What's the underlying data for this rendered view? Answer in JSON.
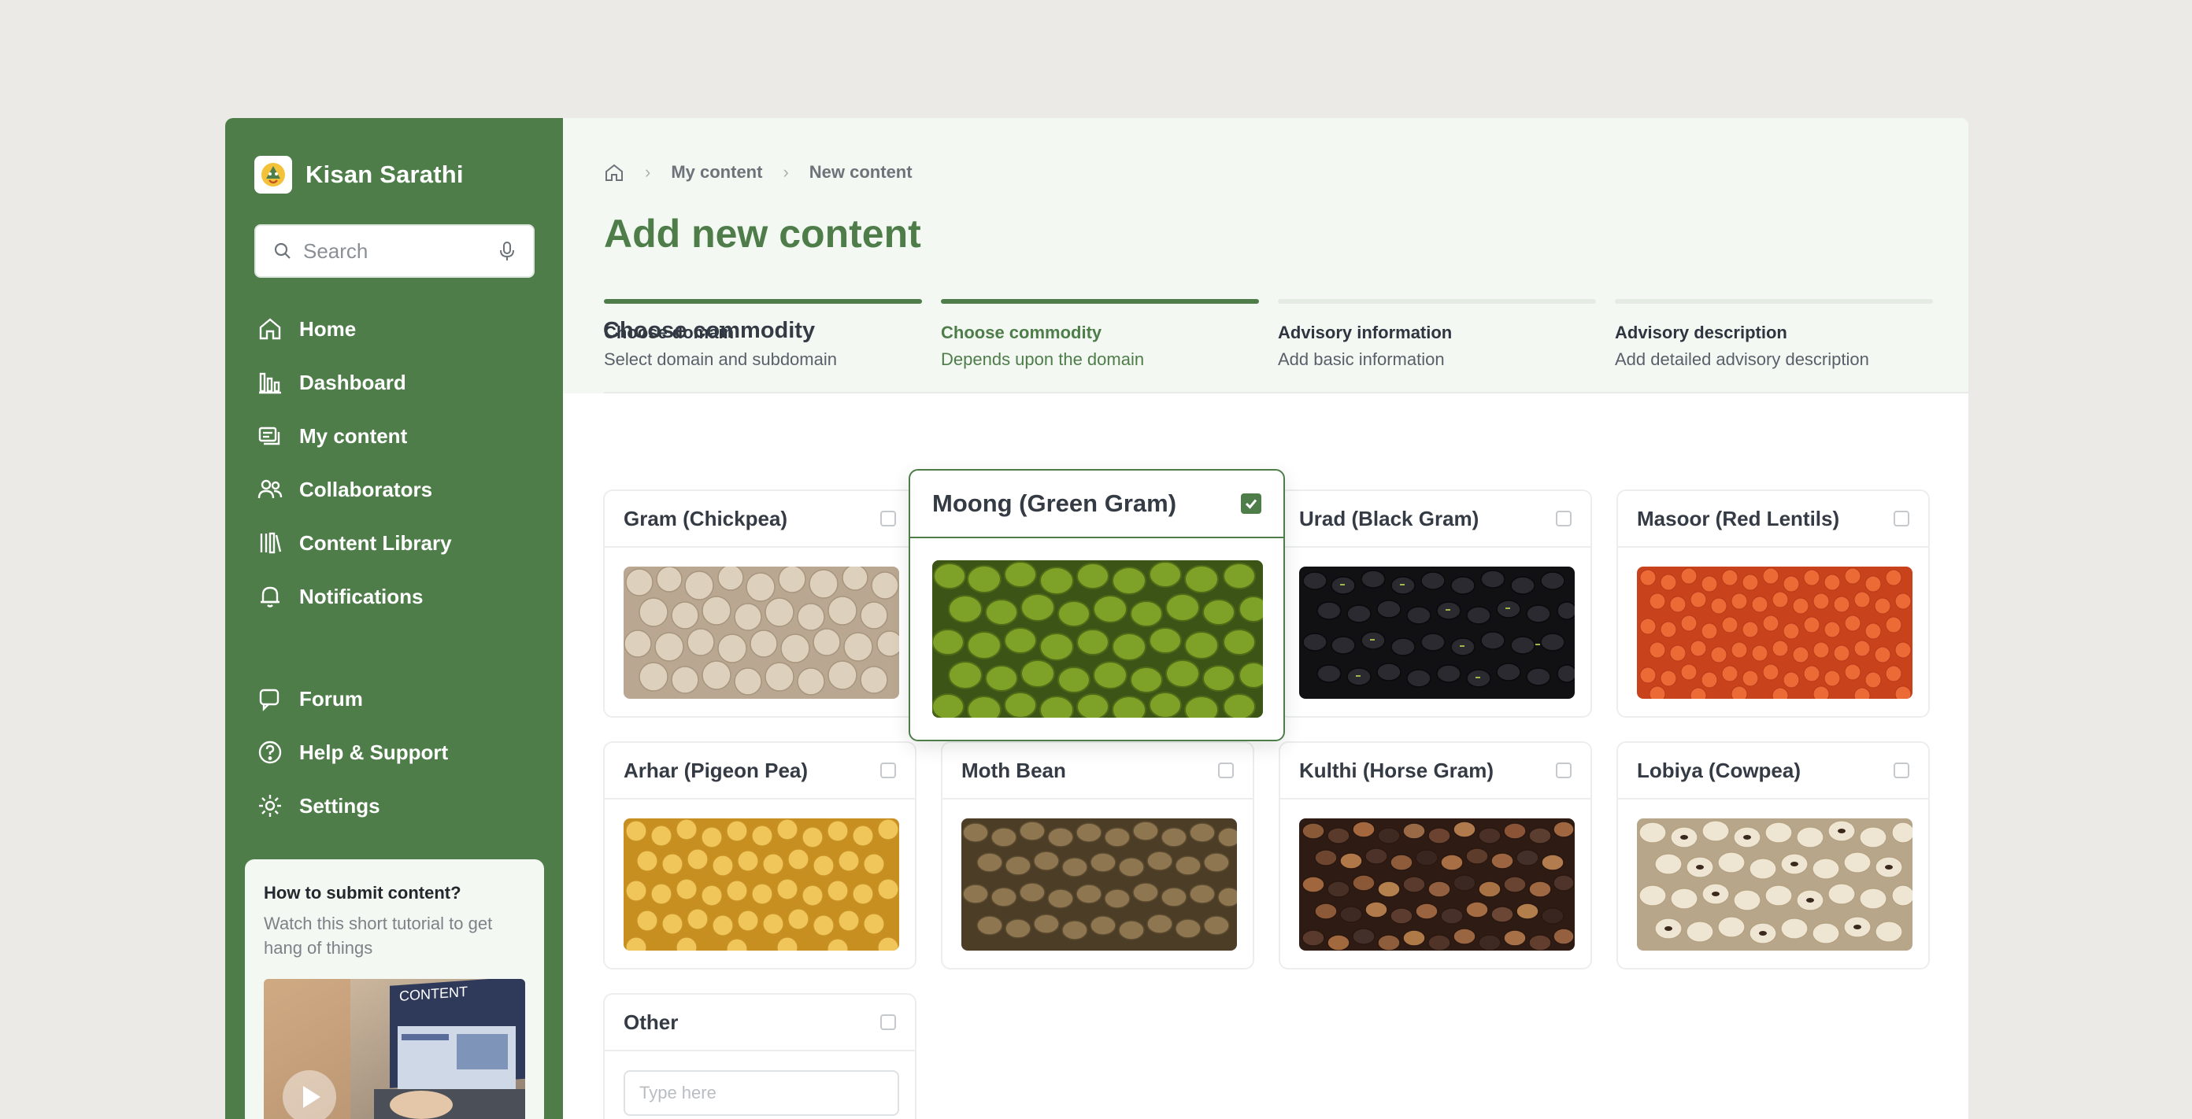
{
  "app": {
    "name": "Kisan Sarathi"
  },
  "search": {
    "placeholder": "Search"
  },
  "nav": {
    "main": [
      {
        "label": "Home",
        "icon": "home-icon"
      },
      {
        "label": "Dashboard",
        "icon": "dashboard-icon"
      },
      {
        "label": "My content",
        "icon": "content-icon"
      },
      {
        "label": "Collaborators",
        "icon": "users-icon"
      },
      {
        "label": "Content Library",
        "icon": "library-icon"
      },
      {
        "label": "Notifications",
        "icon": "bell-icon"
      }
    ],
    "secondary": [
      {
        "label": "Forum",
        "icon": "chat-icon"
      },
      {
        "label": "Help & Support",
        "icon": "help-icon"
      },
      {
        "label": "Settings",
        "icon": "gear-icon"
      }
    ]
  },
  "tutorial": {
    "title": "How to submit content?",
    "description": "Watch this short tutorial to get hang of things",
    "thumbnail_text": "CONTENT"
  },
  "breadcrumb": {
    "items": [
      "My content",
      "New content"
    ]
  },
  "page": {
    "title": "Add new content"
  },
  "steps": [
    {
      "title": "Choose domain",
      "subtitle": "Select domain and subdomain",
      "state": "complete"
    },
    {
      "title": "Choose commodity",
      "subtitle": "Depends upon the domain",
      "state": "current"
    },
    {
      "title": "Advisory information",
      "subtitle": "Add basic information",
      "state": "pending"
    },
    {
      "title": "Advisory description",
      "subtitle": "Add detailed advisory description",
      "state": "pending"
    }
  ],
  "commodity": {
    "section_title": "Choose commodity",
    "items": [
      {
        "name": "Gram (Chickpea)",
        "checked": false,
        "color": "#c9b8a3"
      },
      {
        "name": "Moong (Green Gram)",
        "checked": true,
        "color": "#6e8f23"
      },
      {
        "name": "Urad (Black Gram)",
        "checked": false,
        "color": "#1e1e22"
      },
      {
        "name": "Masoor (Red Lentils)",
        "checked": false,
        "color": "#df5a2a"
      },
      {
        "name": "Arhar (Pigeon Pea)",
        "checked": false,
        "color": "#e3b84a"
      },
      {
        "name": "Moth Bean",
        "checked": false,
        "color": "#7a6442"
      },
      {
        "name": "Kulthi (Horse Gram)",
        "checked": false,
        "color": "#6b3f2a"
      },
      {
        "name": "Lobiya (Cowpea)",
        "checked": false,
        "color": "#e3d7c4"
      }
    ],
    "other": {
      "label": "Other",
      "placeholder": "Type here"
    }
  },
  "colors": {
    "brand": "#4e7d4a",
    "header_bg": "#f3f8f2",
    "page_bg": "#ebeae7"
  }
}
